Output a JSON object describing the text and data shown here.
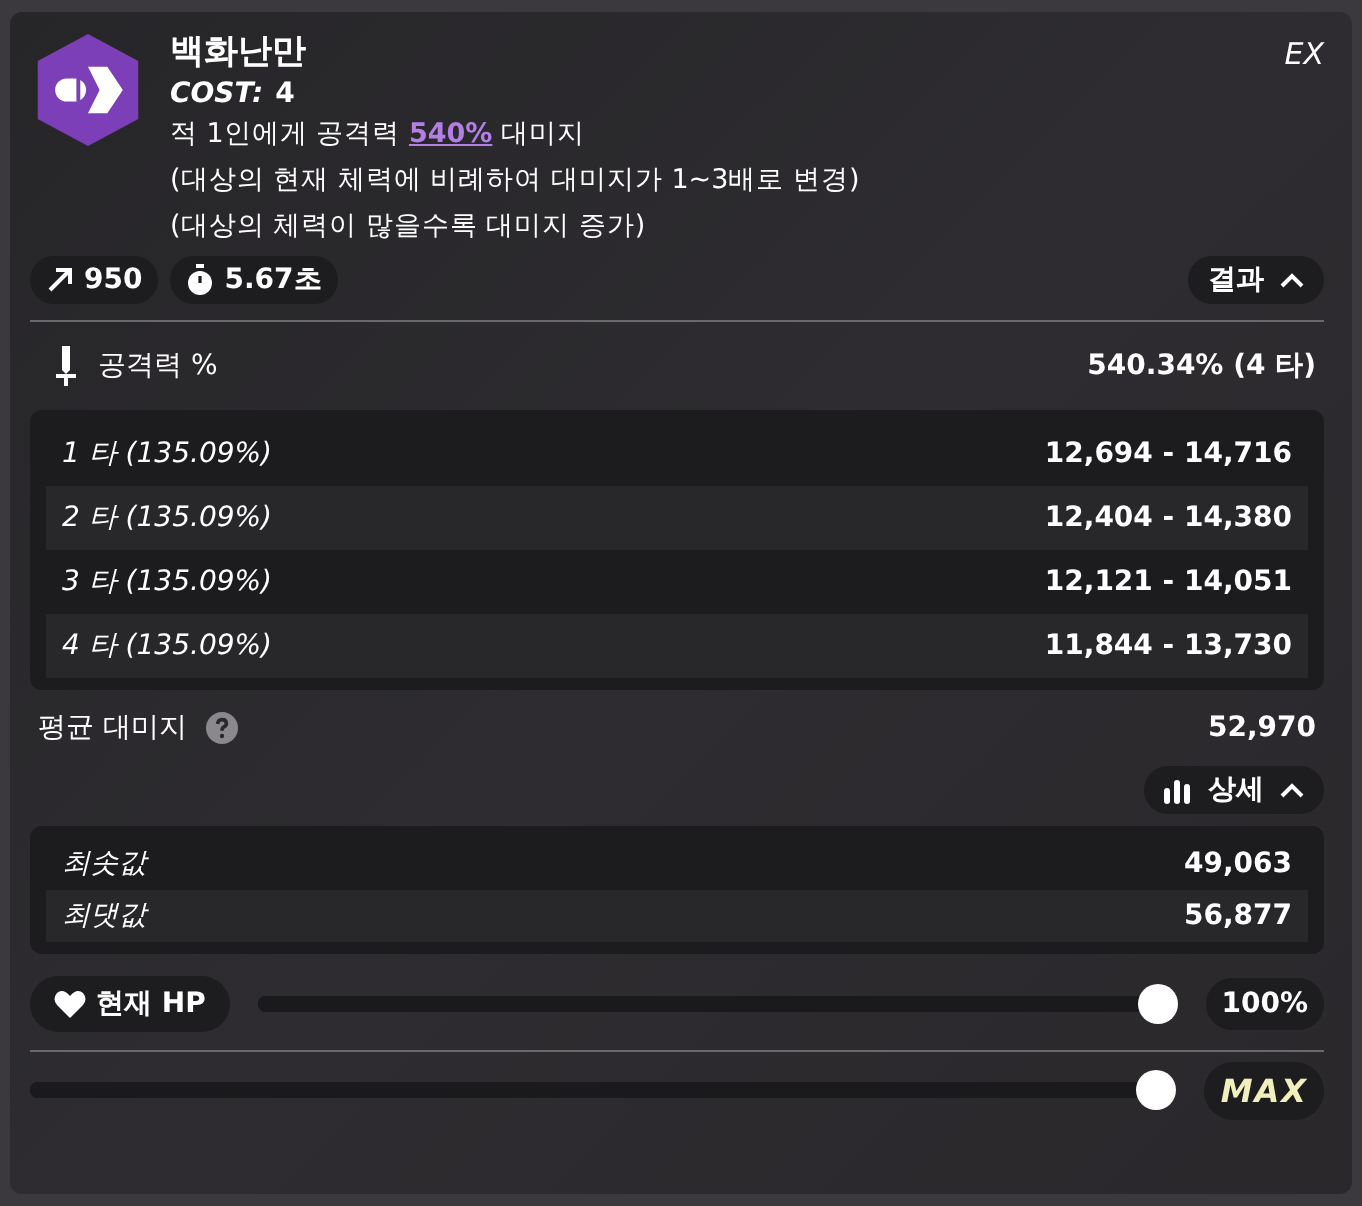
{
  "skill": {
    "name": "백화난만",
    "cost_label": "COST:",
    "cost": "4",
    "grade": "EX",
    "description": [
      {
        "parts": [
          {
            "text": "적 1인에게 공격력 ",
            "highlight": false
          },
          {
            "text": "540%",
            "highlight": true
          },
          {
            "text": " 대미지",
            "highlight": false
          }
        ]
      },
      {
        "parts": [
          {
            "text": "(대상의 현재 체력에 비례하여 대미지가 1~3배로 변경)",
            "highlight": false
          }
        ]
      },
      {
        "parts": [
          {
            "text": "(대상의 체력이 많을수록 대미지 증가)",
            "highlight": false
          }
        ]
      }
    ]
  },
  "stats": [
    {
      "kind": "range",
      "value": "950"
    },
    {
      "kind": "time",
      "value": "5.67초"
    }
  ],
  "results_toggle": {
    "label": "결과",
    "expanded": true
  },
  "attack": {
    "label": "공격력 %",
    "value": "540.34% (4 타)"
  },
  "hits": [
    {
      "label": "1 타 (135.09%)",
      "value": "12,694 - 14,716"
    },
    {
      "label": "2 타 (135.09%)",
      "value": "12,404 - 14,380"
    },
    {
      "label": "3 타 (135.09%)",
      "value": "12,121 - 14,051"
    },
    {
      "label": "4 타 (135.09%)",
      "value": "11,844 - 13,730"
    }
  ],
  "average": {
    "label": "평균 대미지",
    "value": "52,970"
  },
  "details_toggle": {
    "label": "상세",
    "expanded": true
  },
  "extremes": [
    {
      "label": "최솟값",
      "value": "49,063"
    },
    {
      "label": "최댓값",
      "value": "56,877"
    }
  ],
  "hp_slider": {
    "label": "현재 HP",
    "level": 1,
    "reading": "100%"
  },
  "level_slider": {
    "level": 1,
    "reading": "MAX"
  }
}
